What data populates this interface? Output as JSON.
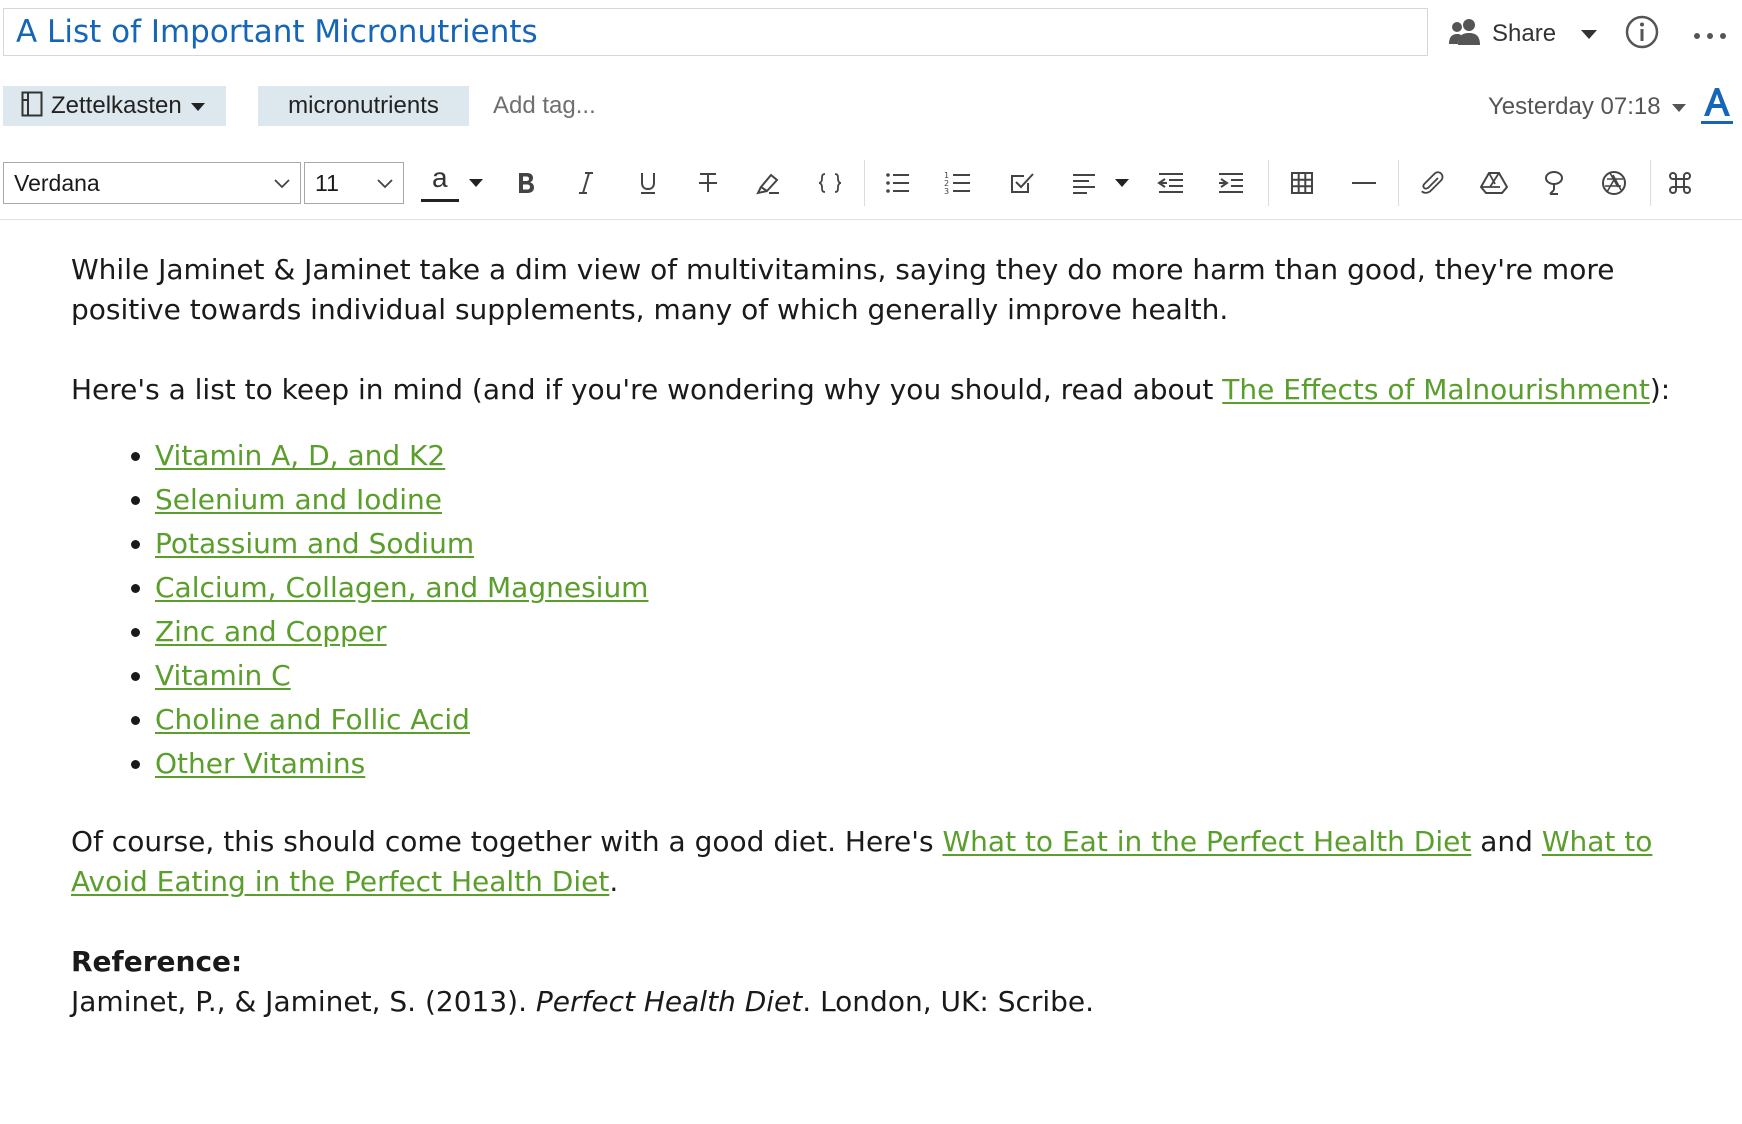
{
  "note": {
    "title": "A List of Important Micronutrients",
    "share_label": "Share",
    "notebook": "Zettelkasten",
    "tags": [
      "micronutrients"
    ],
    "add_tag_placeholder": "Add tag...",
    "updated": "Yesterday 07:18"
  },
  "toolbar": {
    "font_family": "Verdana",
    "font_size": "11",
    "text_color_glyph": "a",
    "buttons": [
      "bold-icon",
      "italic-icon",
      "underline-icon",
      "strikethrough-icon",
      "highlight-icon",
      "code-icon",
      "bullet-list-icon",
      "numbered-list-icon",
      "checkbox-icon",
      "align-icon",
      "outdent-icon",
      "indent-icon",
      "table-icon",
      "divider-icon",
      "attachment-icon",
      "drive-icon",
      "sketch-icon",
      "aperture-icon",
      "command-icon"
    ]
  },
  "content": {
    "para1": "While Jaminet & Jaminet take a dim view of multivitamins, saying they do more harm than good, they're more positive towards individual supplements, many of which generally improve health.",
    "para2_before": "Here's a list to keep in mind (and if you're wondering why you should, read about ",
    "para2_link": "The Effects of Malnourishment",
    "para2_after": "):",
    "list": [
      "Vitamin A, D, and K2",
      "Selenium and Iodine",
      "Potassium and Sodium",
      "Calcium, Collagen, and Magnesium",
      "Zinc and Copper",
      "Vitamin C",
      "Choline and Follic Acid",
      "Other Vitamins"
    ],
    "para3_before": "Of course, this should come together with a good diet. Here's ",
    "para3_link1": "What to Eat in the Perfect Health Diet",
    "para3_mid": " and ",
    "para3_link2": "What to Avoid Eating in the Perfect Health Diet",
    "para3_after": ".",
    "reference_heading": "Reference:",
    "reference_before": "Jaminet, P., & Jaminet, S. (2013). ",
    "reference_italic": "Perfect Health Diet",
    "reference_after": ". London, UK: Scribe."
  },
  "colors": {
    "title": "#1666b8",
    "link": "#5a9e2b",
    "chip_bg": "#dde7ee"
  }
}
